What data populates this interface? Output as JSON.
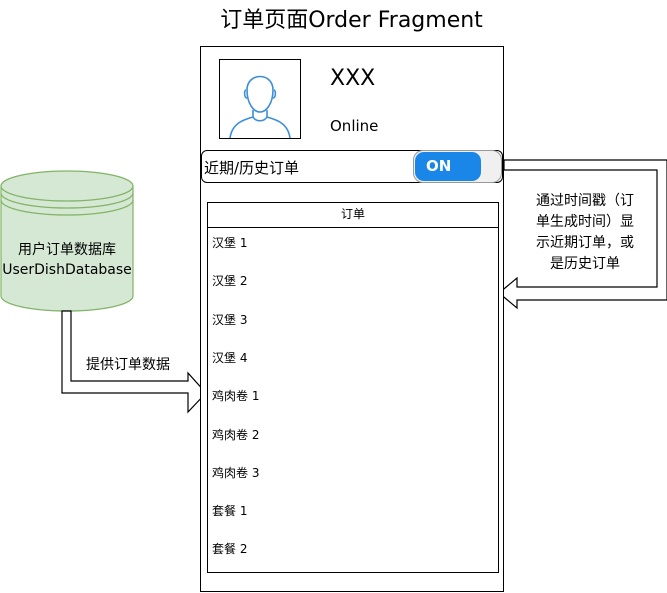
{
  "title": "订单页面Order Fragment",
  "profile": {
    "name": "XXX",
    "status": "Online",
    "avatar_icon": "person-icon"
  },
  "toggle": {
    "label": "近期/历史订单",
    "state": "ON",
    "accent": "#1a87e8"
  },
  "order_list": {
    "header": "订单",
    "items": [
      "汉堡 1",
      "汉堡 2",
      "汉堡 3",
      "汉堡 4",
      "鸡肉卷 1",
      "鸡肉卷 2",
      "鸡肉卷 3",
      "套餐 1",
      "套餐 2"
    ]
  },
  "database": {
    "line1": "用户订单数据库",
    "line2": "UserDishDatabase",
    "fill": "#d5e8d4",
    "stroke": "#82b366"
  },
  "arrow_label": "提供订单数据",
  "note": {
    "line1": "通过时间戳（订",
    "line2": "单生成时间）显",
    "line3": "示近期订单，或",
    "line4": "是历史订单"
  }
}
